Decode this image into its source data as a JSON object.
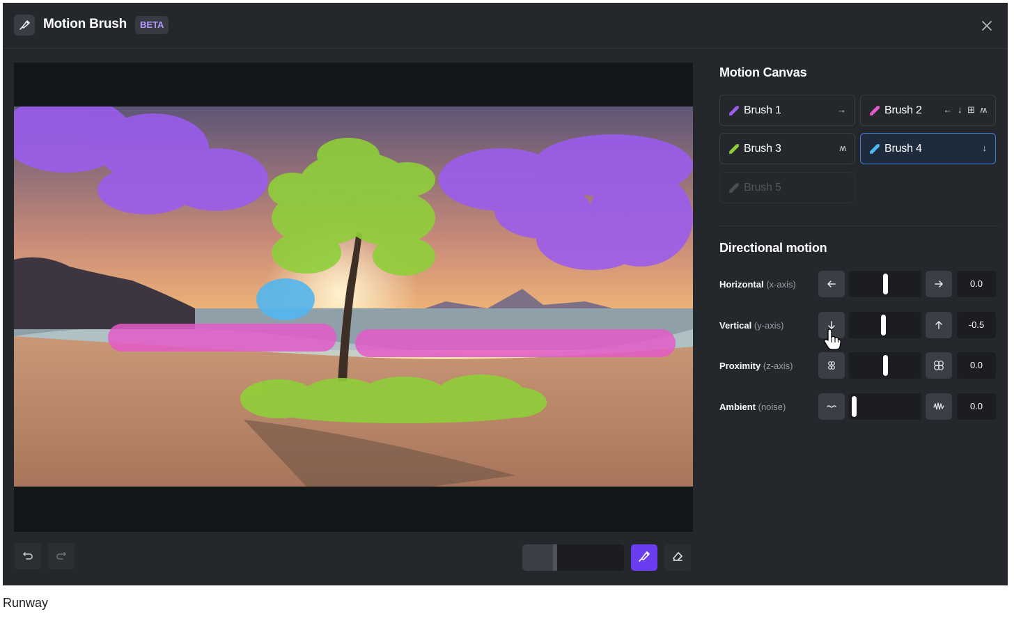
{
  "header": {
    "title": "Motion Brush",
    "badge": "BETA",
    "app_icon": "brush-icon",
    "close_icon": "close-icon"
  },
  "canvas": {
    "image_description_icon": "beach-scene",
    "mask_colors": {
      "purple": "#9b5cf0",
      "green": "#8fcf3a",
      "blue": "#52b6ef",
      "pink": "#e45ac8"
    }
  },
  "toolbar": {
    "undo_icon": "undo-icon",
    "redo_icon": "redo-icon",
    "brush_tool_icon": "brush-tool-icon",
    "eraser_icon": "eraser-icon",
    "brush_size_fraction": 0.34,
    "accent": "#6b3df0"
  },
  "motion_canvas": {
    "title": "Motion Canvas",
    "brushes": [
      {
        "label": "Brush 1",
        "color": "#9b5cf0",
        "arrows": "→",
        "state": "normal"
      },
      {
        "label": "Brush 2",
        "color": "#e45ac8",
        "arrows": "← ↓ ⊞ ʍ",
        "state": "normal"
      },
      {
        "label": "Brush 3",
        "color": "#8fcf3a",
        "arrows": "ʍ",
        "state": "normal"
      },
      {
        "label": "Brush 4",
        "color": "#52b6ef",
        "arrows": "↓",
        "state": "active"
      },
      {
        "label": "Brush 5",
        "color": "#7a7e85",
        "arrows": "",
        "state": "disabled"
      }
    ]
  },
  "directional_motion": {
    "title": "Directional motion",
    "rows": [
      {
        "label": "Horizontal",
        "axis": "(x-axis)",
        "value": "0.0",
        "level": 0.5,
        "minus_icon": "arrow-left-icon",
        "plus_icon": "arrow-right-icon"
      },
      {
        "label": "Vertical",
        "axis": "(y-axis)",
        "value": "-0.5",
        "level": 0.47,
        "minus_icon": "arrow-down-icon",
        "plus_icon": "arrow-up-icon"
      },
      {
        "label": "Proximity",
        "axis": "(z-axis)",
        "value": "0.0",
        "level": 0.5,
        "minus_icon": "shrink-icon",
        "plus_icon": "expand-icon"
      },
      {
        "label": "Ambient",
        "axis": "(noise)",
        "value": "0.0",
        "level": 0.0,
        "minus_icon": "low-noise-icon",
        "plus_icon": "high-noise-icon"
      }
    ]
  },
  "caption": "Runway"
}
